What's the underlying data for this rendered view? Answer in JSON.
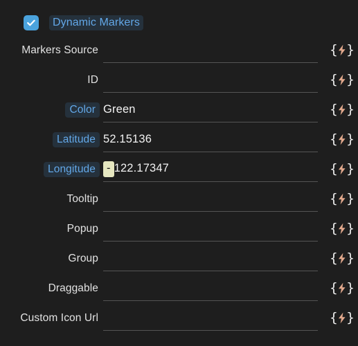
{
  "panel": {
    "background_color": "#1e1e1e",
    "accent_color": "#63a8e8",
    "bolt_color": "#e2a98d",
    "highlight_bg": "#25313c",
    "value_highlight_bg": "#e6e7c0"
  },
  "header": {
    "checkbox_checked": true,
    "checkbox_icon": "check-icon",
    "title": "Dynamic Markers"
  },
  "fields": [
    {
      "label": "Markers Source",
      "label_highlighted": false,
      "value": "",
      "value_prefix": "",
      "binding_icon": "lightning-binding-icon"
    },
    {
      "label": "ID",
      "label_highlighted": false,
      "value": "",
      "value_prefix": "",
      "binding_icon": "lightning-binding-icon"
    },
    {
      "label": "Color",
      "label_highlighted": true,
      "value": "Green",
      "value_prefix": "",
      "binding_icon": "lightning-binding-icon"
    },
    {
      "label": "Latitude",
      "label_highlighted": true,
      "value": "52.15136",
      "value_prefix": "",
      "binding_icon": "lightning-binding-icon"
    },
    {
      "label": "Longitude",
      "label_highlighted": true,
      "value": "122.17347",
      "value_prefix": "-",
      "binding_icon": "lightning-binding-icon"
    },
    {
      "label": "Tooltip",
      "label_highlighted": false,
      "value": "",
      "value_prefix": "",
      "binding_icon": "lightning-binding-icon"
    },
    {
      "label": "Popup",
      "label_highlighted": false,
      "value": "",
      "value_prefix": "",
      "binding_icon": "lightning-binding-icon"
    },
    {
      "label": "Group",
      "label_highlighted": false,
      "value": "",
      "value_prefix": "",
      "binding_icon": "lightning-binding-icon"
    },
    {
      "label": "Draggable",
      "label_highlighted": false,
      "value": "",
      "value_prefix": "",
      "binding_icon": "lightning-binding-icon"
    },
    {
      "label": "Custom Icon Url",
      "label_highlighted": false,
      "value": "",
      "value_prefix": "",
      "binding_icon": "lightning-binding-icon"
    }
  ]
}
